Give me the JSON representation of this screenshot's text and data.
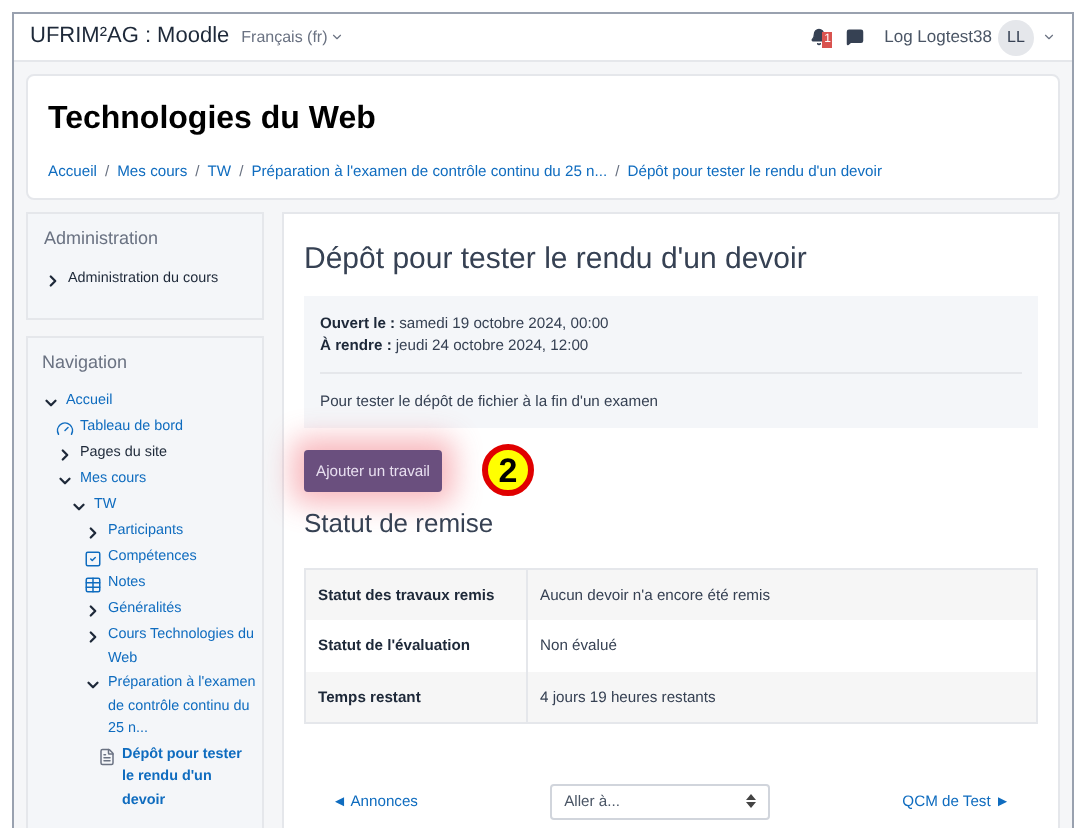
{
  "navbar": {
    "site_name": "UFRIM²AG : Moodle",
    "language": "Français (fr)",
    "notification_count": "1",
    "user_name": "Log Logtest38",
    "avatar_initials": "LL"
  },
  "header": {
    "course_title": "Technologies du Web",
    "breadcrumb_separator": "/",
    "breadcrumb": [
      "Accueil",
      "Mes cours",
      "TW",
      "Préparation à l'examen de contrôle continu du 25 n...",
      "Dépôt pour tester le rendu d'un devoir"
    ]
  },
  "administration": {
    "title": "Administration",
    "items": [
      {
        "label": "Administration du cours",
        "kind": "branch",
        "expanded": false,
        "link": false
      }
    ]
  },
  "navigation": {
    "title": "Navigation",
    "items": [
      {
        "label": "Accueil",
        "kind": "branch",
        "expanded": true,
        "link": true,
        "children": [
          {
            "label": "Tableau de bord",
            "kind": "dashboard",
            "link": true
          },
          {
            "label": "Pages du site",
            "kind": "branch",
            "expanded": false,
            "link": false
          },
          {
            "label": "Mes cours",
            "kind": "branch",
            "expanded": true,
            "link": true,
            "children": [
              {
                "label": "TW",
                "kind": "branch",
                "expanded": true,
                "link": true,
                "children": [
                  {
                    "label": "Participants",
                    "kind": "branch",
                    "expanded": false,
                    "link": true
                  },
                  {
                    "label": "Compétences",
                    "kind": "competencies",
                    "link": true
                  },
                  {
                    "label": "Notes",
                    "kind": "grades",
                    "link": true
                  },
                  {
                    "label": "Généralités",
                    "kind": "branch",
                    "expanded": false,
                    "link": true
                  },
                  {
                    "label": "Cours Technologies du Web",
                    "kind": "branch",
                    "expanded": false,
                    "link": true
                  },
                  {
                    "label": "Préparation à l'examen de contrôle continu du 25 n...",
                    "kind": "branch",
                    "expanded": true,
                    "link": true,
                    "children": [
                      {
                        "label": "Dépôt pour tester le rendu d'un devoir",
                        "kind": "assignment",
                        "link": true,
                        "current": true
                      }
                    ]
                  }
                ]
              }
            ]
          }
        ]
      }
    ]
  },
  "assignment": {
    "title": "Dépôt pour tester le rendu d'un devoir",
    "dates": [
      {
        "label": "Ouvert le :",
        "value": "samedi 19 octobre 2024, 00:00"
      },
      {
        "label": "À rendre :",
        "value": "jeudi 24 octobre 2024, 12:00"
      }
    ],
    "description": "Pour tester le dépôt de fichier à la fin d'un examen",
    "add_button": "Ajouter un travail",
    "callout": "2",
    "status_title": "Statut de remise",
    "status_rows": [
      {
        "label": "Statut des travaux remis",
        "value": "Aucun devoir n'a encore été remis"
      },
      {
        "label": "Statut de l'évaluation",
        "value": "Non évalué"
      },
      {
        "label": "Temps restant",
        "value": "4 jours 19 heures restants"
      }
    ],
    "prev_link": "◄ Annonces",
    "jump_select": {
      "placeholder": "Aller à..."
    },
    "next_link": "QCM de Test ►"
  }
}
